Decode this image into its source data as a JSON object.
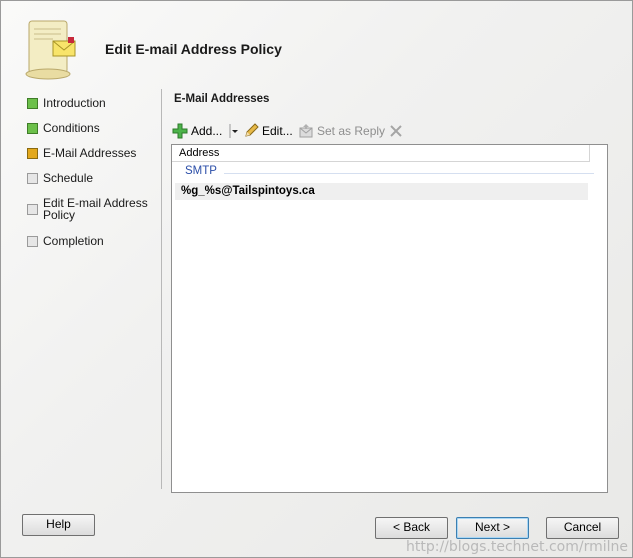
{
  "wizard": {
    "title": "Edit E-mail Address Policy"
  },
  "steps": [
    {
      "label": "Introduction",
      "state": "done"
    },
    {
      "label": "Conditions",
      "state": "done"
    },
    {
      "label": "E-Mail Addresses",
      "state": "current"
    },
    {
      "label": "Schedule",
      "state": "pending"
    },
    {
      "label_line1": "Edit E-mail Address",
      "label_line2": "Policy",
      "state": "pending"
    },
    {
      "label": "Completion",
      "state": "pending"
    }
  ],
  "colors": {
    "done": "#6cc04a",
    "current": "#e3a81c",
    "pending": "#e6e6e6",
    "group_header": "#2b4ea8"
  },
  "section": {
    "title": "E-Mail Addresses"
  },
  "toolbar": {
    "add_label": "Add...",
    "edit_label": "Edit...",
    "set_reply_label": "Set as Reply",
    "icons": [
      "add-icon",
      "dropdown-arrow-icon",
      "pencil-icon",
      "set-as-reply-icon",
      "delete-icon"
    ]
  },
  "list": {
    "column_header": "Address",
    "group": "SMTP",
    "rows": [
      "%g_%s@Tailspintoys.ca"
    ]
  },
  "buttons": {
    "help": "Help",
    "back": "< Back",
    "next": "Next >",
    "cancel": "Cancel"
  },
  "watermark": "http://blogs.technet.com/rmilne"
}
